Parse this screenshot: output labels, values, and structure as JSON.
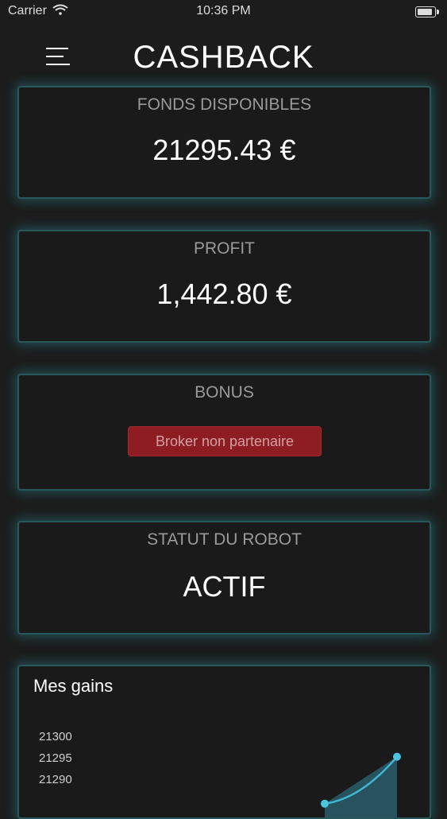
{
  "status_bar": {
    "carrier": "Carrier",
    "time": "10:36 PM"
  },
  "header": {
    "title": "CASHBACK"
  },
  "cards": {
    "funds": {
      "label": "FONDS DISPONIBLES",
      "value": "21295.43 €"
    },
    "profit": {
      "label": "PROFIT",
      "value": "1,442.80 €"
    },
    "bonus": {
      "label": "BONUS",
      "badge": "Broker non partenaire"
    },
    "robot": {
      "label": "STATUT DU ROBOT",
      "status": "ACTIF"
    }
  },
  "chart": {
    "title": "Mes gains"
  },
  "chart_data": {
    "type": "area",
    "title": "Mes gains",
    "y_ticks": [
      "21300",
      "21295",
      "21290"
    ],
    "y_range": [
      21285,
      21300
    ],
    "x": [
      0,
      1
    ],
    "values": [
      21284.5,
      21295.43
    ],
    "colors": {
      "line": "#3fb6cf",
      "fill": "#2a5a66",
      "point": "#4cc4de"
    }
  }
}
